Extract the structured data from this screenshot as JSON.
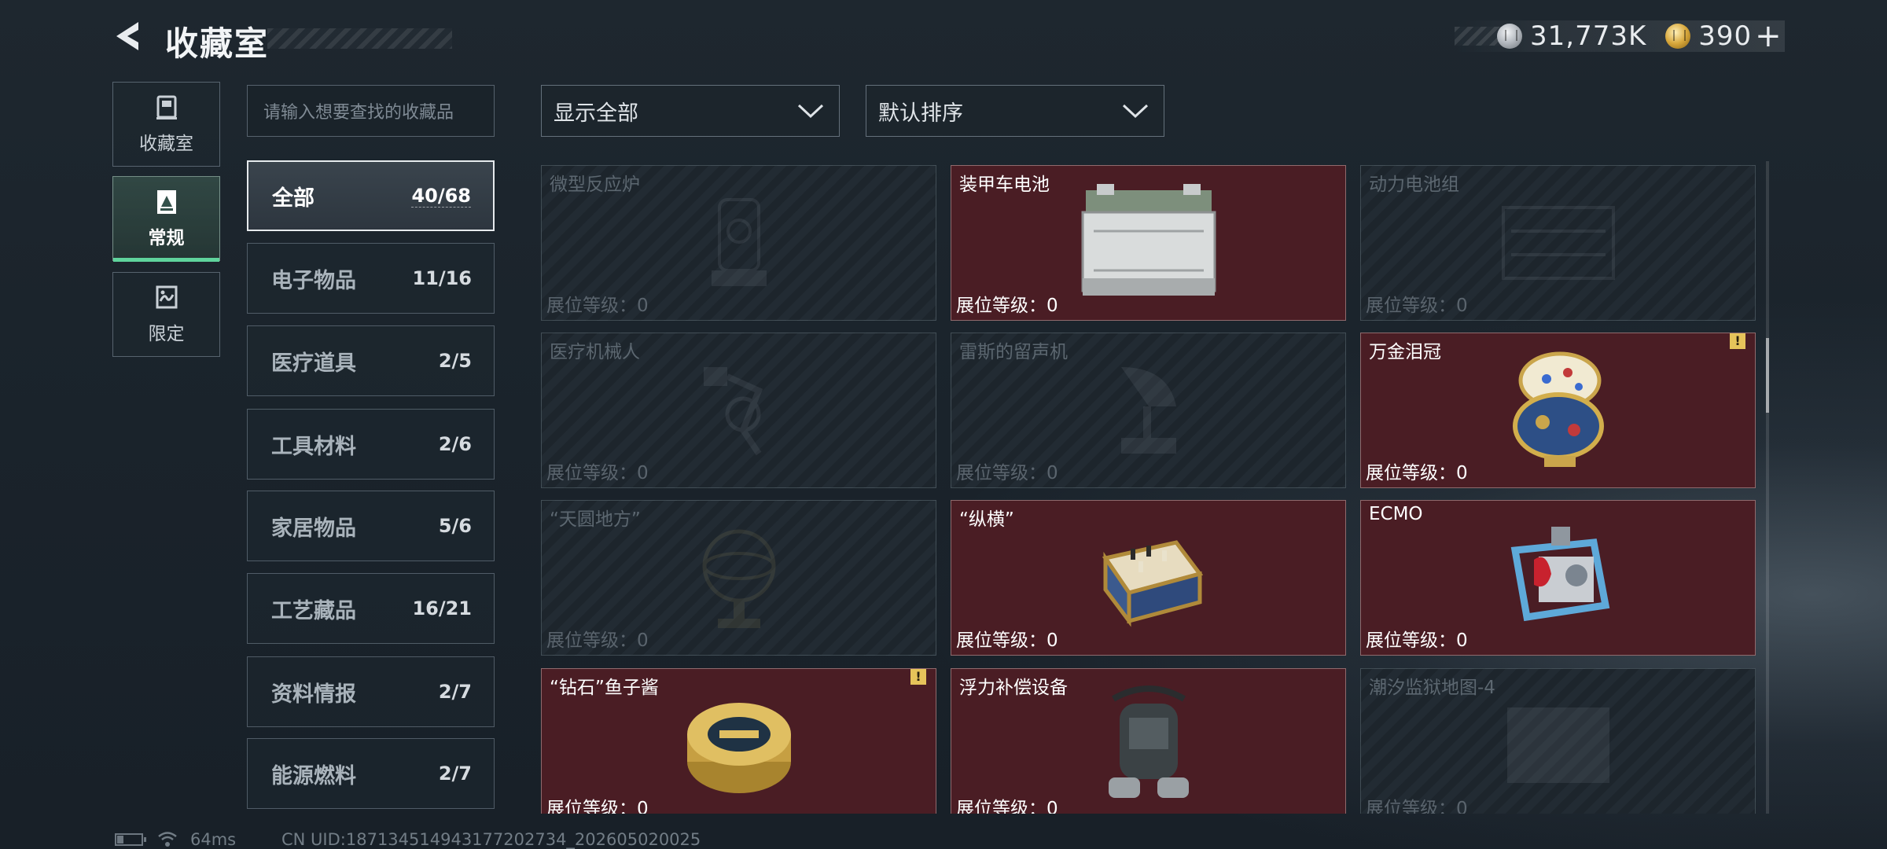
{
  "header": {
    "title": "收藏室",
    "currency_silver": "31,773K",
    "currency_gold": "390",
    "plus_label": "+"
  },
  "sidebar": {
    "tabs": [
      {
        "label": "收藏室",
        "icon": "collection-room-icon",
        "active": false
      },
      {
        "label": "常规",
        "icon": "regular-icon",
        "active": true
      },
      {
        "label": "限定",
        "icon": "limited-icon",
        "active": false
      }
    ]
  },
  "search": {
    "placeholder": "请输入想要查找的收藏品"
  },
  "categories": [
    {
      "label": "全部",
      "count": "40/68",
      "active": true
    },
    {
      "label": "电子物品",
      "count": "11/16"
    },
    {
      "label": "医疗道具",
      "count": "2/5"
    },
    {
      "label": "工具材料",
      "count": "2/6"
    },
    {
      "label": "家居物品",
      "count": "5/6"
    },
    {
      "label": "工艺藏品",
      "count": "16/21"
    },
    {
      "label": "资料情报",
      "count": "2/7"
    },
    {
      "label": "能源燃料",
      "count": "2/7"
    }
  ],
  "filters": {
    "display": "显示全部",
    "sort": "默认排序"
  },
  "level_label": "展位等级：0",
  "items": [
    {
      "name": "微型反应炉",
      "unlocked": false,
      "icon": "reactor-icon"
    },
    {
      "name": "装甲车电池",
      "unlocked": true,
      "icon": "battery-item-icon"
    },
    {
      "name": "动力电池组",
      "unlocked": false,
      "icon": "power-pack-icon"
    },
    {
      "name": "医疗机械人",
      "unlocked": false,
      "icon": "medical-robot-icon"
    },
    {
      "name": "雷斯的留声机",
      "unlocked": false,
      "icon": "gramophone-icon"
    },
    {
      "name": "万金泪冠",
      "unlocked": true,
      "alert": true,
      "icon": "jeweled-egg-icon"
    },
    {
      "name": "“天圆地方”",
      "unlocked": false,
      "icon": "armillary-icon"
    },
    {
      "name": "“纵横”",
      "unlocked": true,
      "icon": "chessboard-icon"
    },
    {
      "name": "ECMO",
      "unlocked": true,
      "icon": "ecmo-icon"
    },
    {
      "name": "“钻石”鱼子酱",
      "unlocked": true,
      "alert": true,
      "icon": "caviar-tin-icon"
    },
    {
      "name": "浮力补偿设备",
      "unlocked": true,
      "icon": "bcd-device-icon"
    },
    {
      "name": "潮汐监狱地图-4",
      "unlocked": false,
      "icon": "map-icon"
    }
  ],
  "alert_mark": "!",
  "status": {
    "ping": "64ms",
    "uid": "CN UID:1871345149431772027​34_202605020025"
  }
}
